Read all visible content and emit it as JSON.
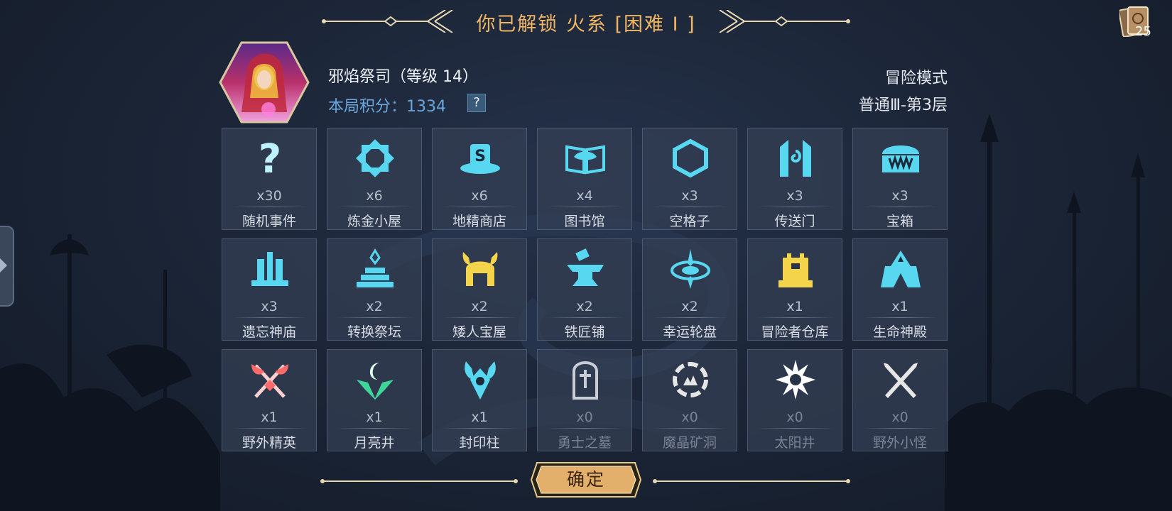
{
  "banner": {
    "title": "你已解锁 火系 [困难 I ]"
  },
  "deck": {
    "count": "25",
    "icon": "card-deck-icon"
  },
  "player": {
    "name": "邪焰祭司（等级 14）",
    "score_label": "本局积分：1334",
    "help": "?",
    "mode": "冒险模式",
    "floor": "普通Ⅲ-第3层"
  },
  "tiles": [
    {
      "count": "x30",
      "name": "随机事件",
      "icon": "question-icon",
      "color": "#8ee6ff"
    },
    {
      "count": "x6",
      "name": "炼金小屋",
      "icon": "alchemy-diamond-icon",
      "color": "#58d8f0"
    },
    {
      "count": "x6",
      "name": "地精商店",
      "icon": "goblin-shop-icon",
      "color": "#58d8f0"
    },
    {
      "count": "x4",
      "name": "图书馆",
      "icon": "library-book-icon",
      "color": "#58d8f0"
    },
    {
      "count": "x3",
      "name": "空格子",
      "icon": "hexagon-icon",
      "color": "#58d8f0"
    },
    {
      "count": "x3",
      "name": "传送门",
      "icon": "portal-icon",
      "color": "#58d8f0"
    },
    {
      "count": "x3",
      "name": "宝箱",
      "icon": "treasure-chest-icon",
      "color": "#58d8f0"
    },
    {
      "count": "x3",
      "name": "遗忘神庙",
      "icon": "temple-icon",
      "color": "#58d8f0"
    },
    {
      "count": "x2",
      "name": "转换祭坛",
      "icon": "altar-icon",
      "color": "#58d8f0"
    },
    {
      "count": "x2",
      "name": "矮人宝屋",
      "icon": "dwarf-helmet-icon",
      "color": "#f4d44a"
    },
    {
      "count": "x2",
      "name": "铁匠铺",
      "icon": "anvil-icon",
      "color": "#58d8f0"
    },
    {
      "count": "x2",
      "name": "幸运轮盘",
      "icon": "wheel-icon",
      "color": "#58d8f0"
    },
    {
      "count": "x1",
      "name": "冒险者仓库",
      "icon": "warehouse-icon",
      "color": "#f4d44a"
    },
    {
      "count": "x1",
      "name": "生命神殿",
      "icon": "life-temple-icon",
      "color": "#58d8f0"
    },
    {
      "count": "x1",
      "name": "野外精英",
      "icon": "crossed-axes-icon",
      "color": "#ff8a8a"
    },
    {
      "count": "x1",
      "name": "月亮井",
      "icon": "moon-well-icon",
      "color": "#3fd69a"
    },
    {
      "count": "x1",
      "name": "封印柱",
      "icon": "seal-pillar-icon",
      "color": "#58d8f0"
    },
    {
      "count": "x0",
      "name": "勇士之墓",
      "icon": "tombstone-icon",
      "color": "#c9ced6",
      "dim": true
    },
    {
      "count": "x0",
      "name": "魔晶矿洞",
      "icon": "crystal-mine-icon",
      "color": "#e6e6e6",
      "dim": true
    },
    {
      "count": "x0",
      "name": "太阳井",
      "icon": "sun-icon",
      "color": "#ffffff",
      "dim": true
    },
    {
      "count": "x0",
      "name": "野外小怪",
      "icon": "crossed-swords-icon",
      "color": "#e6e6e6",
      "dim": true
    }
  ],
  "confirm": {
    "label": "确定"
  }
}
